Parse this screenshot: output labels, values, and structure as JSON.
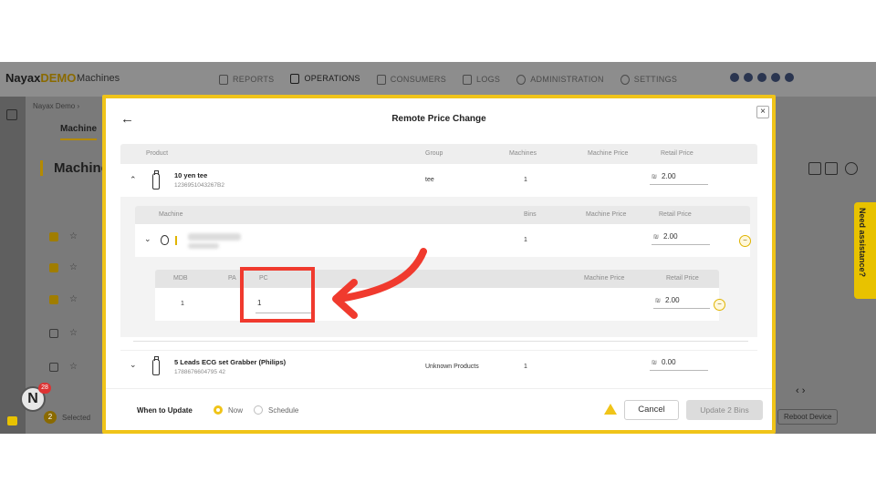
{
  "app": {
    "brand": "Nayax",
    "brand_accent": "DEMO",
    "section": "Machines",
    "nav": [
      {
        "label": "REPORTS",
        "icon": "reports-icon"
      },
      {
        "label": "OPERATIONS",
        "icon": "operations-icon",
        "active": true
      },
      {
        "label": "CONSUMERS",
        "icon": "consumers-icon"
      },
      {
        "label": "LOGS",
        "icon": "logs-icon"
      },
      {
        "label": "ADMINISTRATION",
        "icon": "administration-icon"
      },
      {
        "label": "SETTINGS",
        "icon": "settings-icon"
      }
    ]
  },
  "background": {
    "breadcrumb": "Nayax Demo  ›",
    "tab": "Machine",
    "title": "Machine",
    "footer_count": "2",
    "footer_label": "Selected",
    "reboot_label": "Reboot Device",
    "pagination": "‹   ›",
    "assistance_label": "Need assistance?",
    "notification_count": "28",
    "avatar_letter": "N"
  },
  "modal": {
    "back_label": "←",
    "title": "Remote Price Change",
    "close_label": "×",
    "product_headers": {
      "product": "Product",
      "group": "Group",
      "machines": "Machines",
      "machine_price": "Machine Price",
      "retail_price": "Retail Price"
    },
    "products": [
      {
        "name": "10 yen tee",
        "code": "1236951043267B2",
        "group": "tee",
        "machines": "1",
        "currency": "₪",
        "retail_price": "2.00",
        "expanded": true
      },
      {
        "name": "5 Leads ECG set Grabber (Philips)",
        "code": "1788676604795 42",
        "group": "Unknown Products",
        "machines": "1",
        "currency": "₪",
        "retail_price": "0.00",
        "expanded": false
      }
    ],
    "machine_headers": {
      "machine": "Machine",
      "bins": "Bins",
      "machine_price": "Machine Price",
      "retail_price": "Retail Price"
    },
    "machine_row": {
      "bins": "1",
      "currency": "₪",
      "retail_price": "2.00"
    },
    "bin_headers": {
      "mdb": "MDB",
      "pa": "PA",
      "pc": "PC",
      "machine_price": "Machine Price",
      "retail_price": "Retail Price"
    },
    "bin_row": {
      "mdb": "1",
      "pc": "1",
      "currency": "₪",
      "retail_price": "2.00"
    },
    "footer": {
      "when_label": "When to Update",
      "now_label": "Now",
      "schedule_label": "Schedule",
      "selected_option": "Now",
      "cancel_label": "Cancel",
      "update_label": "Update 2 Bins"
    }
  },
  "colors": {
    "accent": "#f0c419",
    "highlight": "#f03a2e",
    "disabled_button": "#dcdcdc"
  }
}
